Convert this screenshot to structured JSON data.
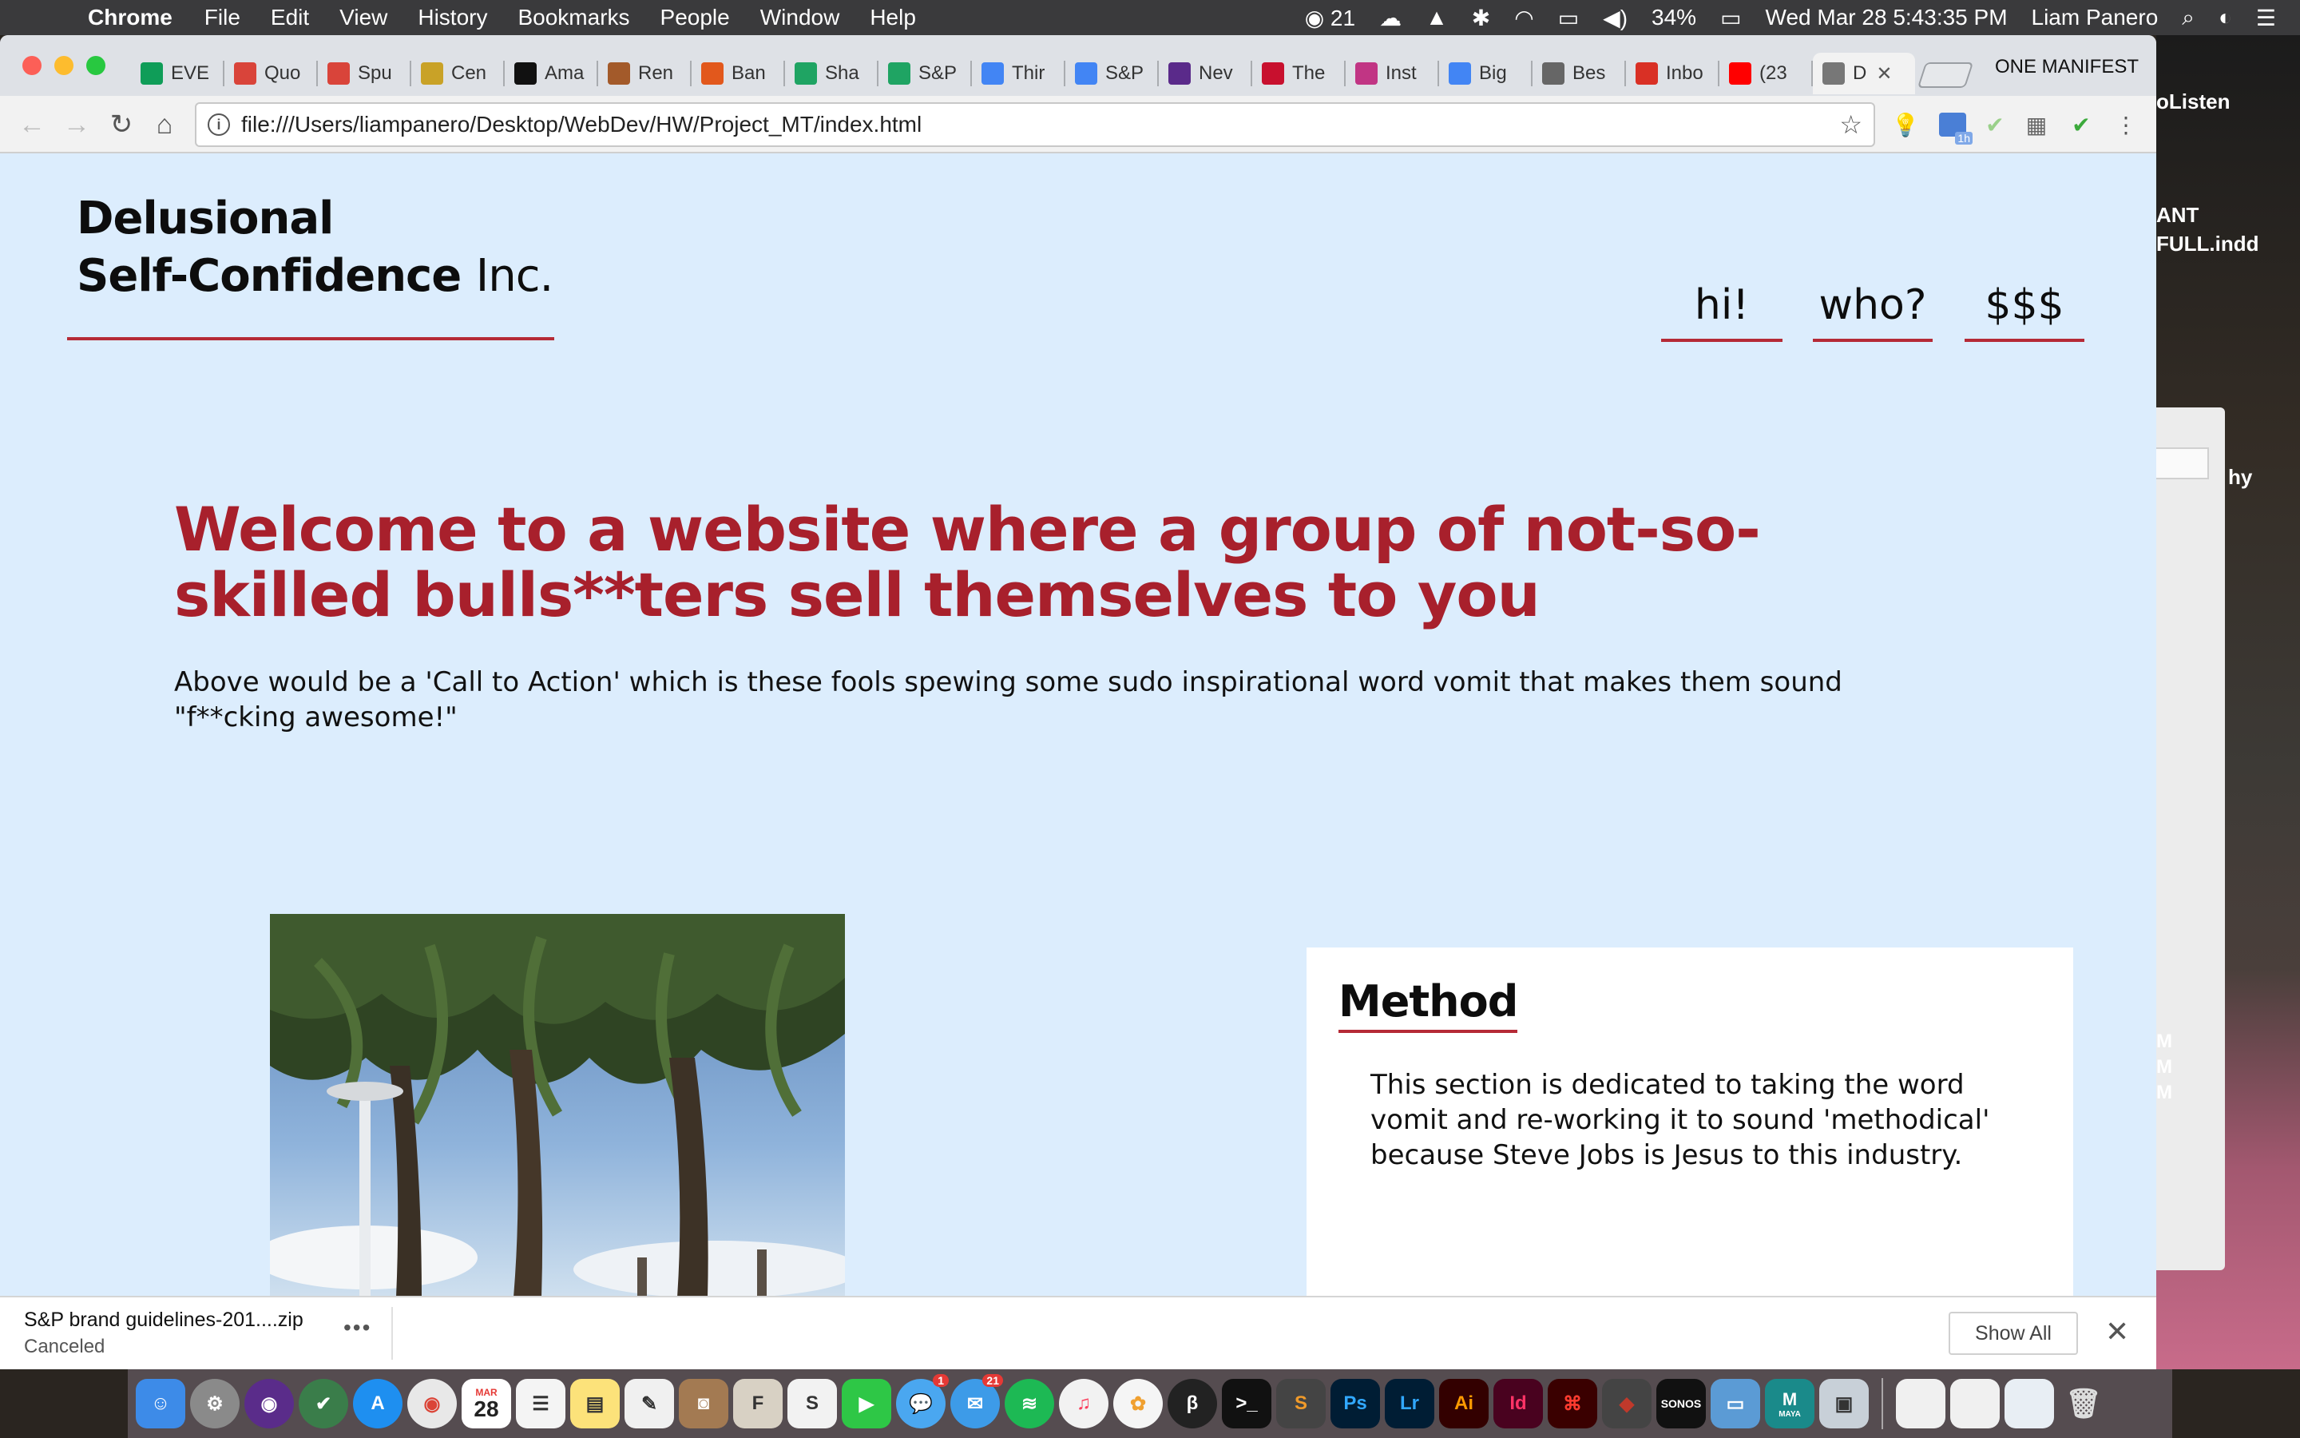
{
  "menubar": {
    "app": "Chrome",
    "items": [
      "File",
      "Edit",
      "View",
      "History",
      "Bookmarks",
      "People",
      "Window",
      "Help"
    ],
    "status_count": "21",
    "battery": "34%",
    "datetime": "Wed Mar 28  5:43:35 PM",
    "user": "Liam Panero"
  },
  "tabs": [
    {
      "label": "EVE",
      "icon": "sheets-icon",
      "color": "#0f9d58"
    },
    {
      "label": "Quo",
      "icon": "pr-icon",
      "color": "#d9443a"
    },
    {
      "label": "Spu",
      "icon": "pr-icon",
      "color": "#d9443a"
    },
    {
      "label": "Cen",
      "icon": "lighthouse-icon",
      "color": "#c9a227"
    },
    {
      "label": "Ama",
      "icon": "amazon-icon",
      "color": "#111111"
    },
    {
      "label": "Ren",
      "icon": "ren-icon",
      "color": "#a35a2a"
    },
    {
      "label": "Ban",
      "icon": "eg-icon",
      "color": "#e2581c"
    },
    {
      "label": "Sha",
      "icon": "drive-icon",
      "color": "#1fa463"
    },
    {
      "label": "S&P",
      "icon": "drive-icon",
      "color": "#1fa463"
    },
    {
      "label": "Thir",
      "icon": "docs-icon",
      "color": "#4285f4"
    },
    {
      "label": "S&P",
      "icon": "docs-icon",
      "color": "#4285f4"
    },
    {
      "label": "Nev",
      "icon": "nev-icon",
      "color": "#5a2a8a"
    },
    {
      "label": "The",
      "icon": "ufc-icon",
      "color": "#c8102e"
    },
    {
      "label": "Inst",
      "icon": "instagram-icon",
      "color": "#c13584"
    },
    {
      "label": "Big",
      "icon": "google-icon",
      "color": "#4285f4"
    },
    {
      "label": "Bes",
      "icon": "bes-icon",
      "color": "#666666"
    },
    {
      "label": "Inbo",
      "icon": "gmail-icon",
      "color": "#d93025"
    },
    {
      "label": "(23",
      "icon": "youtube-icon",
      "color": "#ff0000"
    },
    {
      "label": "D",
      "icon": "file-icon",
      "color": "#777777"
    }
  ],
  "profile_name": "ONE MANIFEST",
  "address": "file:///Users/liampanero/Desktop/WebDev/HW/Project_MT/index.html",
  "extensions": {
    "badge": "1h"
  },
  "page": {
    "brand_line1": "Delusional",
    "brand_line2_bold": "Self-Confidence",
    "brand_line2_light": "Inc.",
    "nav": [
      "hi!",
      "who?",
      "$$$"
    ],
    "headline": "Welcome to a website where a group of not-so-skilled bulls**ters sell themselves to you",
    "cta": "Above would be a 'Call to Action' which is these fools spewing some sudo inspirational word vomit that makes them sound \"f**cking awesome!\"",
    "method_title": "Method",
    "method_text": "This section is dedicated to taking the word vomit and re-working it to sound 'methodical' because Steve Jobs is Jesus to this industry.",
    "accent_color": "#a8202c",
    "background_color": "#dcedfd"
  },
  "downloads": {
    "filename": "S&P brand guidelines-201....zip",
    "status": "Canceled",
    "show_all": "Show All"
  },
  "desktop": {
    "labels": [
      "oListen",
      "ANT",
      "FULL.indd",
      "hy",
      "M",
      "M",
      "M"
    ]
  },
  "dock": {
    "calendar_day": "28",
    "calendar_month": "MAR",
    "mail_badge": "1",
    "messages_badge": "21",
    "sonos_label": "SONOS",
    "maya_label": "MAYA"
  }
}
